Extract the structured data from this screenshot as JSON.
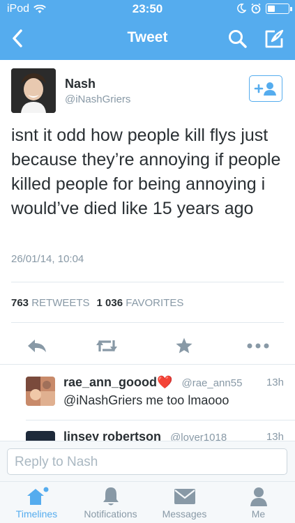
{
  "status_bar": {
    "carrier": "iPod",
    "time": "23:50",
    "battery_level": 0.3
  },
  "nav": {
    "title": "Tweet"
  },
  "tweet": {
    "author_name": "Nash",
    "author_handle": "@iNashGriers",
    "text": "isnt it odd how people kill flys just because they’re annoying if people killed people for being annoying i would’ve died like 15 years ago",
    "timestamp": "26/01/14, 10:04",
    "retweet_count": "763",
    "retweet_label": "RETWEETS",
    "favorite_count": "1 036",
    "favorite_label": "FAVORITES"
  },
  "replies": [
    {
      "name": "rae_ann_goood",
      "emoji": "❤️",
      "handle": "@rae_ann55",
      "time": "13h",
      "text": "@iNashGriers me too lmaooo"
    },
    {
      "name": "linsey robertson",
      "handle": "@lover1018",
      "time": "13h"
    }
  ],
  "reply_bar": {
    "placeholder": "Reply to Nash"
  },
  "tabs": [
    {
      "label": "Timelines",
      "icon": "home-icon",
      "active": true
    },
    {
      "label": "Notifications",
      "icon": "bell-icon"
    },
    {
      "label": "Messages",
      "icon": "envelope-icon"
    },
    {
      "label": "Me",
      "icon": "person-icon"
    }
  ],
  "colors": {
    "brand": "#55acee",
    "text": "#292f33",
    "muted": "#8899a6"
  }
}
